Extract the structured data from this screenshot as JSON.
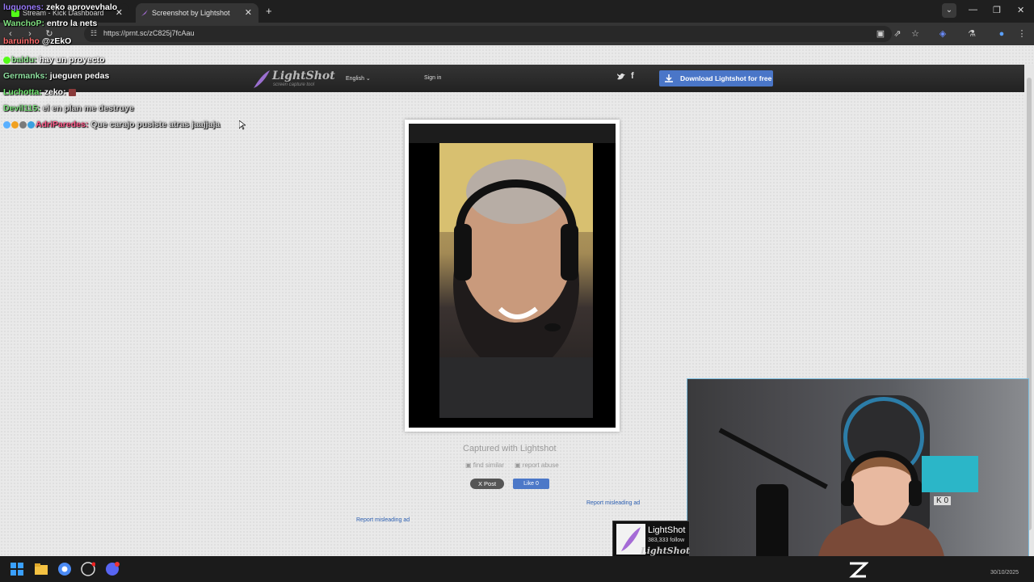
{
  "browser": {
    "tabs": [
      {
        "title": "Stream - Kick Dashboard",
        "active": false
      },
      {
        "title": "Screenshot by Lightshot",
        "active": true
      }
    ],
    "new_tab": "+",
    "close": "✕",
    "url": "https://prnt.sc/zC825j7fcAau"
  },
  "chat": [
    {
      "user": "luquones:",
      "message": "zeko aprovevhalo",
      "user_color": "#9b7bff"
    },
    {
      "user": "WanchoP:",
      "message": "entro la nets",
      "user_color": "#7fe07f"
    },
    {
      "user": "baruinho",
      "message": "@zEkO",
      "user_color": "#ff6b6b"
    },
    {
      "user": "baldu:",
      "message": "hay un proyecto",
      "user_color": "#8fe88f"
    },
    {
      "user": "Germanks:",
      "message": "jueguen pedas",
      "user_color": "#8fe0a0"
    },
    {
      "user": "Luchotta:",
      "message": "zeko:",
      "user_color": "#6ee86e"
    },
    {
      "user": "Devil115:",
      "message": "el en plan me destruye",
      "user_color": "#7ce07c"
    },
    {
      "user": "AdriParedes:",
      "message": "Que carajo pusiste atras jaajjaja",
      "user_color": "#ff5a8a"
    }
  ],
  "lightshot": {
    "logo_text": "LightShot",
    "logo_sub": "screen capture tool",
    "language": "English",
    "signin": "Sign in",
    "download_label": "Download Lightshot for free",
    "captured_text": "Captured with Lightshot",
    "find_similar": "find similar",
    "report_abuse": "report abuse",
    "x_post": "X Post",
    "fb_like": "Like 0",
    "report_misleading": "Report misleading ad"
  },
  "follow_widget": {
    "name": "LightShot",
    "count": "383,333 follow",
    "brand": "LightShot"
  },
  "webcam": {
    "keypad": "K  0"
  },
  "taskbar": {
    "date": "30/10/2025"
  },
  "colors": {
    "download_button": "#4a76c8",
    "chrome_dark": "#1f1f1f",
    "page_bg": "#e9e9e9"
  }
}
